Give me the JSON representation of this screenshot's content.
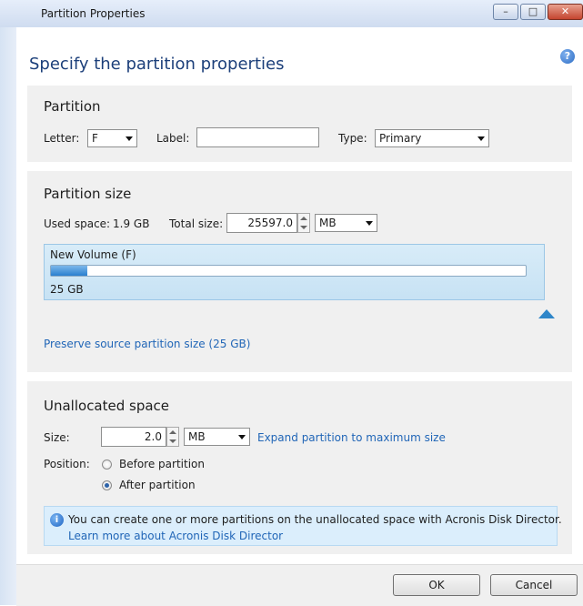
{
  "window": {
    "title": "Partition Properties",
    "minimize_glyph": "–",
    "maximize_glyph": "□",
    "close_glyph": "✕"
  },
  "header": {
    "title": "Specify the partition properties",
    "help_glyph": "?"
  },
  "partition": {
    "section_title": "Partition",
    "letter_label": "Letter:",
    "letter_value": "F",
    "label_label": "Label:",
    "label_value": "",
    "type_label": "Type:",
    "type_value": "Primary"
  },
  "size": {
    "section_title": "Partition size",
    "used_space_label": "Used space:",
    "used_space_value": "1.9 GB",
    "total_size_label": "Total size:",
    "total_size_value": "25597.0",
    "unit": "MB",
    "volume_name": "New Volume (F)",
    "volume_size": "25 GB",
    "used_fraction": 0.076,
    "preserve_link": "Preserve source partition size (25 GB)"
  },
  "unallocated": {
    "section_title": "Unallocated space",
    "size_label": "Size:",
    "size_value": "2.0",
    "unit": "MB",
    "expand_link": "Expand partition to maximum size",
    "position_label": "Position:",
    "before_label": "Before partition",
    "after_label": "After partition",
    "selected_position": "after",
    "info_glyph": "i",
    "info_text": "You can create one or more partitions on the unallocated space with Acronis Disk Director.",
    "info_link": "Learn more about Acronis Disk Director"
  },
  "footer": {
    "ok_label": "OK",
    "cancel_label": "Cancel"
  },
  "colors": {
    "header_text": "#1c3f7a",
    "link": "#2166b7",
    "section_bg": "#f0f0f0",
    "bar_fill": "#2a7fcf"
  }
}
